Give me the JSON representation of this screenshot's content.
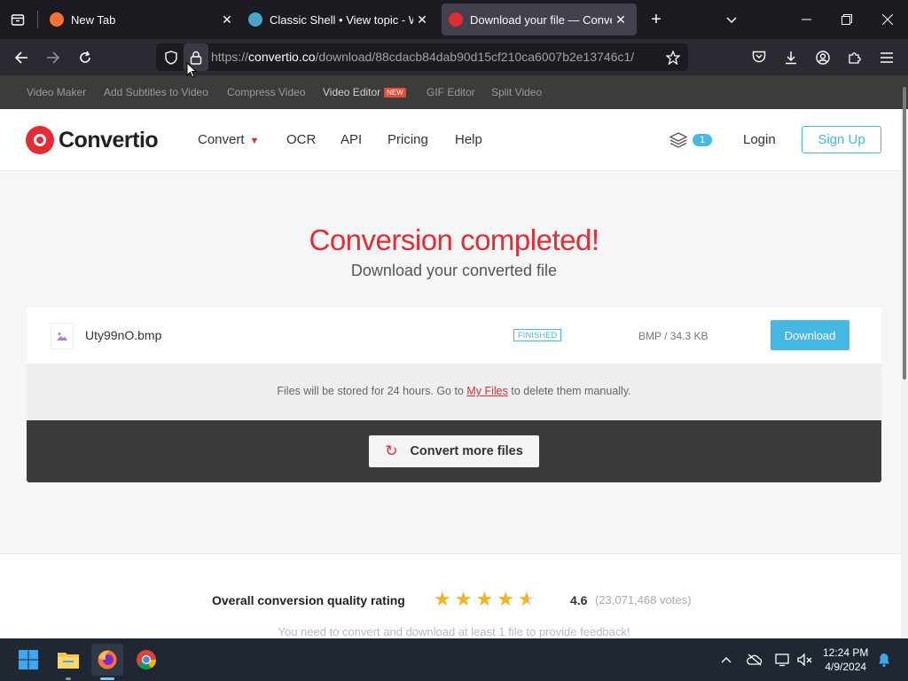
{
  "browser": {
    "tabs": [
      {
        "title": "New Tab",
        "close": "✕",
        "favicon_color": "#ff7139"
      },
      {
        "title": "Classic Shell • View topic - Wind",
        "close": "✕",
        "favicon_color": "#4aa3c8"
      },
      {
        "title": "Download your file — Convertio",
        "close": "✕",
        "favicon_color": "#e42c35"
      }
    ],
    "url_host": "convertio.co",
    "url_prefix": "https://",
    "url_path": "/download/88cdacb84dab90d15cf210ca6007b2e13746c1/"
  },
  "subnav": {
    "items": [
      "Video Maker",
      "Add Subtitles to Video",
      "Compress Video",
      "Video Editor",
      "GIF Editor",
      "Split Video"
    ],
    "new_badge": "NEW"
  },
  "header": {
    "logo": "Convertio",
    "nav": [
      "Convert",
      "OCR",
      "API",
      "Pricing",
      "Help"
    ],
    "stack_count": "1",
    "login": "Login",
    "signup": "Sign Up"
  },
  "main": {
    "title": "Conversion completed!",
    "subtitle": "Download your converted file",
    "file": {
      "name": "Uty99nO.bmp",
      "status": "FINISHED",
      "meta": "BMP / 34.3 KB",
      "download": "Download"
    },
    "storage_before": "Files will be stored for 24 hours. Go to ",
    "storage_link": "My Files",
    "storage_after": " to delete them manually.",
    "convert_more": "Convert more files"
  },
  "rating": {
    "label": "Overall conversion quality rating",
    "score": "4.6",
    "votes": "(23,071,468 votes)",
    "stars": 4.5,
    "feedback": "You need to convert and download at least 1 file to provide feedback!"
  },
  "taskbar": {
    "time": "12:24 PM",
    "date": "4/9/2024"
  },
  "colors": {
    "brand_red": "#e42c35",
    "accent_blue": "#46b8e4",
    "star": "#f5b31b"
  }
}
